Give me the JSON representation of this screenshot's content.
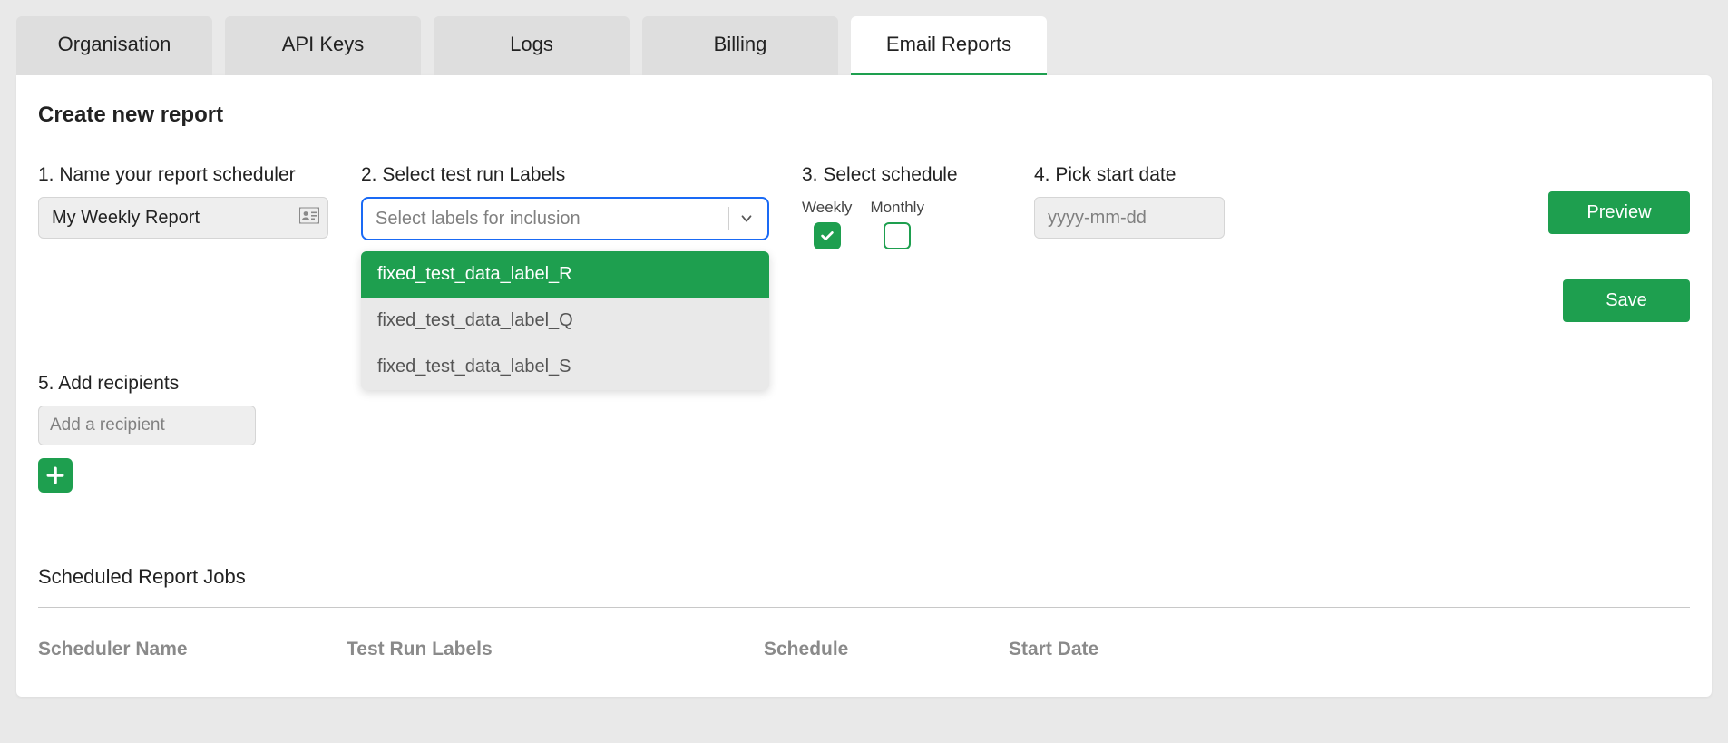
{
  "tabs": [
    {
      "label": "Organisation",
      "active": false
    },
    {
      "label": "API Keys",
      "active": false
    },
    {
      "label": "Logs",
      "active": false
    },
    {
      "label": "Billing",
      "active": false
    },
    {
      "label": "Email Reports",
      "active": true
    }
  ],
  "sectionTitle": "Create new report",
  "steps": {
    "name": {
      "label": "1. Name your report scheduler",
      "value": "My Weekly Report"
    },
    "labels": {
      "label": "2. Select test run Labels",
      "placeholder": "Select labels for inclusion"
    },
    "schedule": {
      "label": "3. Select schedule",
      "weekly": "Weekly",
      "monthly": "Monthly",
      "weeklyChecked": true,
      "monthlyChecked": false
    },
    "date": {
      "label": "4. Pick start date",
      "placeholder": "yyyy-mm-dd"
    },
    "recipients": {
      "label": "5. Add recipients",
      "placeholder": "Add a recipient"
    }
  },
  "dropdownOptions": [
    {
      "label": "fixed_test_data_label_R",
      "highlighted": true
    },
    {
      "label": "fixed_test_data_label_Q",
      "highlighted": false
    },
    {
      "label": "fixed_test_data_label_S",
      "highlighted": false
    }
  ],
  "buttons": {
    "preview": "Preview",
    "save": "Save"
  },
  "jobs": {
    "title": "Scheduled Report Jobs",
    "headers": {
      "name": "Scheduler Name",
      "labels": "Test Run Labels",
      "sched": "Schedule",
      "date": "Start Date"
    }
  },
  "colors": {
    "accent": "#1e9f4f",
    "focus": "#1a6af5"
  }
}
